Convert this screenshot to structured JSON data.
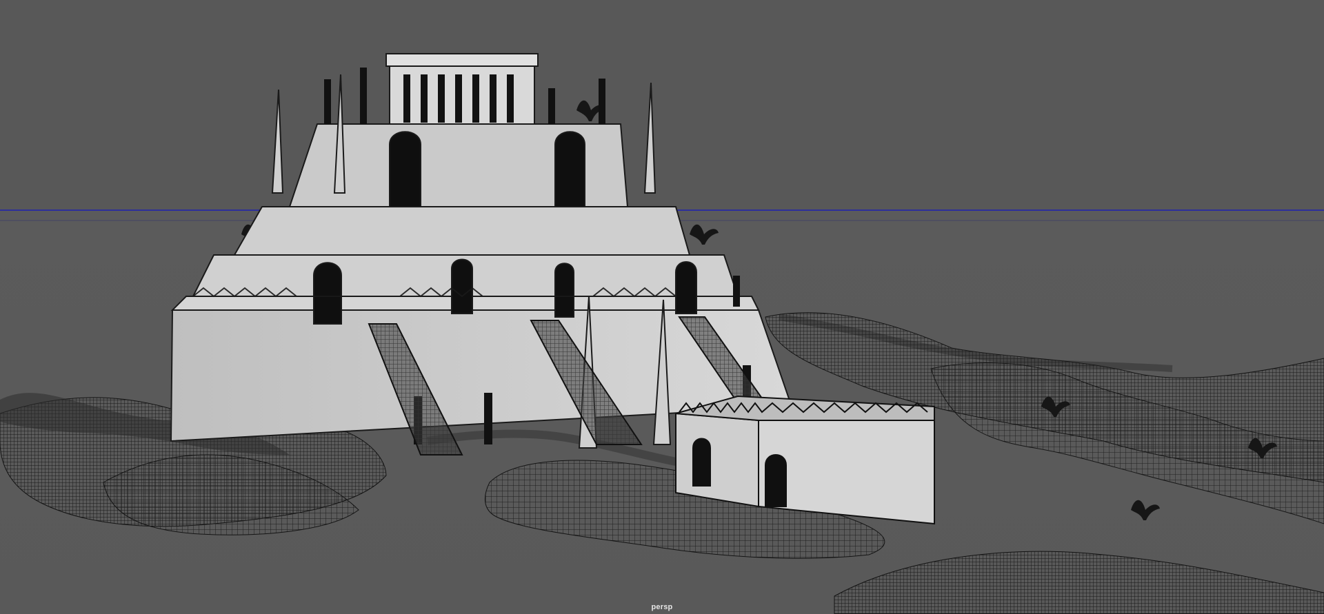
{
  "viewport": {
    "camera_label": "persp",
    "background_color": "#585858",
    "ground_color": "#5b5b5b",
    "horizon_color": "#2d2f9a",
    "wireframe_color": "#111111",
    "model_fill_color": "#bdbdbd"
  },
  "scene": {
    "main_object": "ziggurat-temple-model",
    "elements": [
      "horizon-line",
      "ziggurat-temple",
      "gatehouse",
      "terrain-wireframe",
      "palm-tree-icons",
      "obelisks",
      "columns"
    ]
  }
}
